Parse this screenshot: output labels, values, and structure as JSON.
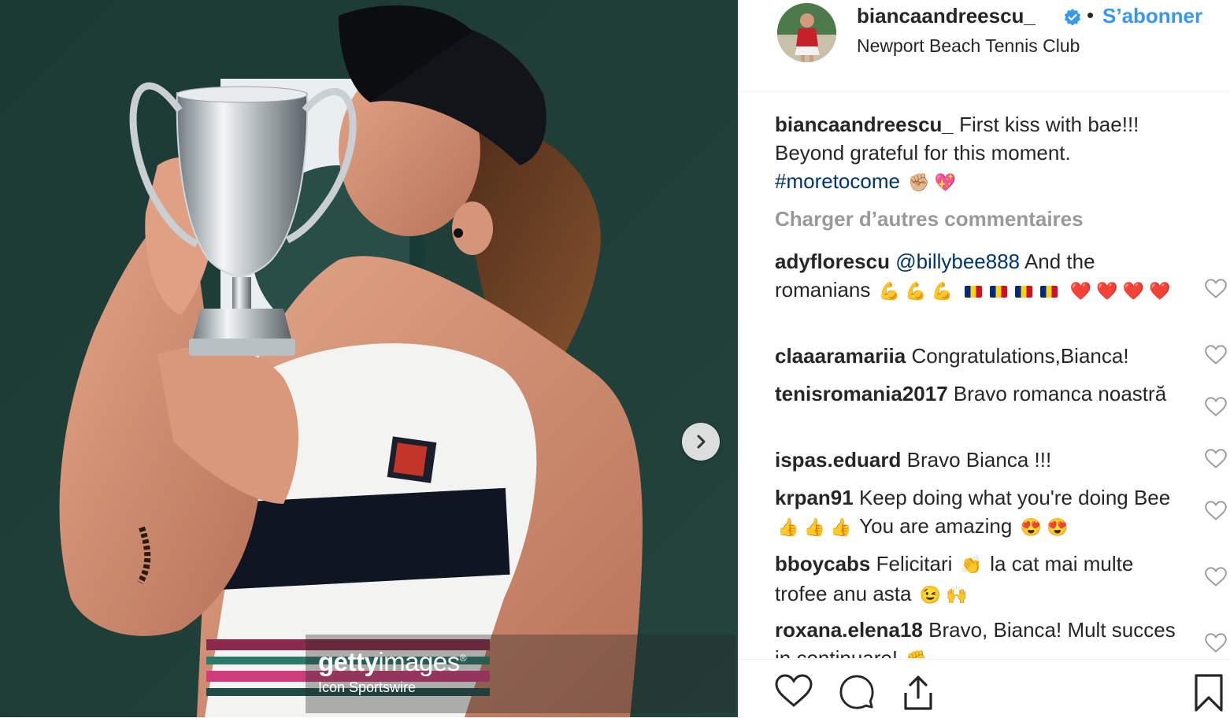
{
  "post": {
    "username": "biancaandreescu_",
    "follow_label": "S’abonner",
    "separator": "•",
    "location": "Newport Beach Tennis Club",
    "image_watermark": {
      "brand_light": "getty",
      "brand_rest": "images",
      "reg": "®",
      "credit": "Icon Sportswire"
    },
    "next_icon": "chevron-right-icon"
  },
  "caption": {
    "username": "biancaandreescu_",
    "text": "First kiss with bae!!! Beyond grateful for this moment.",
    "hashtag": "#moretocome",
    "emojis": [
      "✊🏼",
      "💖"
    ]
  },
  "load_more": "Charger d’autres commentaires",
  "comments": [
    {
      "user": "adyflorescu",
      "mention": "@billybee888",
      "text": "And the romanians",
      "emojis": "💪 💪 💪",
      "flags": 4,
      "hearts": "❤️ ❤️ ❤️ ❤️"
    },
    {
      "user": "claaaramariia",
      "text": "Congratulations,Bianca!"
    },
    {
      "user": "tenisromania2017",
      "text": "Bravo romanca noastră"
    },
    {
      "user": "ispas.eduard",
      "text": "Bravo Bianca !!!"
    },
    {
      "user": "krpan91",
      "text": "Keep doing what you're doing Bee",
      "emojis_mid": "👍 👍 👍",
      "text2": "You are amazing",
      "emojis_end": "😍 😍"
    },
    {
      "user": "bboycabs",
      "text": "Felicitari",
      "emoji1": "👏",
      "text2": "la cat mai multe trofee anu asta",
      "emojis_end": "😉 🙌"
    },
    {
      "user": "roxana.elena18",
      "text": "Bravo, Bianca! Mult succes in continuare!",
      "emoji_end": "✊"
    }
  ],
  "icons": {
    "like": "heart-icon",
    "comment": "comment-icon",
    "share": "share-icon",
    "save": "bookmark-icon"
  },
  "colors": {
    "link": "#3897f0",
    "hashtag": "#003569",
    "muted": "#999999",
    "text": "#262626"
  }
}
